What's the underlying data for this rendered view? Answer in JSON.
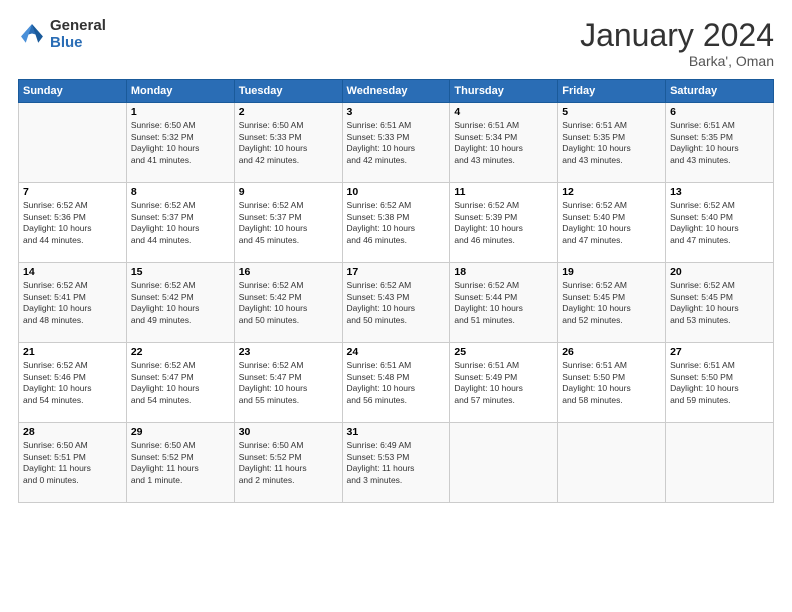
{
  "header": {
    "logo_general": "General",
    "logo_blue": "Blue",
    "month_title": "January 2024",
    "subtitle": "Barka', Oman"
  },
  "weekdays": [
    "Sunday",
    "Monday",
    "Tuesday",
    "Wednesday",
    "Thursday",
    "Friday",
    "Saturday"
  ],
  "weeks": [
    [
      {
        "day": "",
        "info": ""
      },
      {
        "day": "1",
        "info": "Sunrise: 6:50 AM\nSunset: 5:32 PM\nDaylight: 10 hours\nand 41 minutes."
      },
      {
        "day": "2",
        "info": "Sunrise: 6:50 AM\nSunset: 5:33 PM\nDaylight: 10 hours\nand 42 minutes."
      },
      {
        "day": "3",
        "info": "Sunrise: 6:51 AM\nSunset: 5:33 PM\nDaylight: 10 hours\nand 42 minutes."
      },
      {
        "day": "4",
        "info": "Sunrise: 6:51 AM\nSunset: 5:34 PM\nDaylight: 10 hours\nand 43 minutes."
      },
      {
        "day": "5",
        "info": "Sunrise: 6:51 AM\nSunset: 5:35 PM\nDaylight: 10 hours\nand 43 minutes."
      },
      {
        "day": "6",
        "info": "Sunrise: 6:51 AM\nSunset: 5:35 PM\nDaylight: 10 hours\nand 43 minutes."
      }
    ],
    [
      {
        "day": "7",
        "info": "Sunrise: 6:52 AM\nSunset: 5:36 PM\nDaylight: 10 hours\nand 44 minutes."
      },
      {
        "day": "8",
        "info": "Sunrise: 6:52 AM\nSunset: 5:37 PM\nDaylight: 10 hours\nand 44 minutes."
      },
      {
        "day": "9",
        "info": "Sunrise: 6:52 AM\nSunset: 5:37 PM\nDaylight: 10 hours\nand 45 minutes."
      },
      {
        "day": "10",
        "info": "Sunrise: 6:52 AM\nSunset: 5:38 PM\nDaylight: 10 hours\nand 46 minutes."
      },
      {
        "day": "11",
        "info": "Sunrise: 6:52 AM\nSunset: 5:39 PM\nDaylight: 10 hours\nand 46 minutes."
      },
      {
        "day": "12",
        "info": "Sunrise: 6:52 AM\nSunset: 5:40 PM\nDaylight: 10 hours\nand 47 minutes."
      },
      {
        "day": "13",
        "info": "Sunrise: 6:52 AM\nSunset: 5:40 PM\nDaylight: 10 hours\nand 47 minutes."
      }
    ],
    [
      {
        "day": "14",
        "info": "Sunrise: 6:52 AM\nSunset: 5:41 PM\nDaylight: 10 hours\nand 48 minutes."
      },
      {
        "day": "15",
        "info": "Sunrise: 6:52 AM\nSunset: 5:42 PM\nDaylight: 10 hours\nand 49 minutes."
      },
      {
        "day": "16",
        "info": "Sunrise: 6:52 AM\nSunset: 5:42 PM\nDaylight: 10 hours\nand 50 minutes."
      },
      {
        "day": "17",
        "info": "Sunrise: 6:52 AM\nSunset: 5:43 PM\nDaylight: 10 hours\nand 50 minutes."
      },
      {
        "day": "18",
        "info": "Sunrise: 6:52 AM\nSunset: 5:44 PM\nDaylight: 10 hours\nand 51 minutes."
      },
      {
        "day": "19",
        "info": "Sunrise: 6:52 AM\nSunset: 5:45 PM\nDaylight: 10 hours\nand 52 minutes."
      },
      {
        "day": "20",
        "info": "Sunrise: 6:52 AM\nSunset: 5:45 PM\nDaylight: 10 hours\nand 53 minutes."
      }
    ],
    [
      {
        "day": "21",
        "info": "Sunrise: 6:52 AM\nSunset: 5:46 PM\nDaylight: 10 hours\nand 54 minutes."
      },
      {
        "day": "22",
        "info": "Sunrise: 6:52 AM\nSunset: 5:47 PM\nDaylight: 10 hours\nand 54 minutes."
      },
      {
        "day": "23",
        "info": "Sunrise: 6:52 AM\nSunset: 5:47 PM\nDaylight: 10 hours\nand 55 minutes."
      },
      {
        "day": "24",
        "info": "Sunrise: 6:51 AM\nSunset: 5:48 PM\nDaylight: 10 hours\nand 56 minutes."
      },
      {
        "day": "25",
        "info": "Sunrise: 6:51 AM\nSunset: 5:49 PM\nDaylight: 10 hours\nand 57 minutes."
      },
      {
        "day": "26",
        "info": "Sunrise: 6:51 AM\nSunset: 5:50 PM\nDaylight: 10 hours\nand 58 minutes."
      },
      {
        "day": "27",
        "info": "Sunrise: 6:51 AM\nSunset: 5:50 PM\nDaylight: 10 hours\nand 59 minutes."
      }
    ],
    [
      {
        "day": "28",
        "info": "Sunrise: 6:50 AM\nSunset: 5:51 PM\nDaylight: 11 hours\nand 0 minutes."
      },
      {
        "day": "29",
        "info": "Sunrise: 6:50 AM\nSunset: 5:52 PM\nDaylight: 11 hours\nand 1 minute."
      },
      {
        "day": "30",
        "info": "Sunrise: 6:50 AM\nSunset: 5:52 PM\nDaylight: 11 hours\nand 2 minutes."
      },
      {
        "day": "31",
        "info": "Sunrise: 6:49 AM\nSunset: 5:53 PM\nDaylight: 11 hours\nand 3 minutes."
      },
      {
        "day": "",
        "info": ""
      },
      {
        "day": "",
        "info": ""
      },
      {
        "day": "",
        "info": ""
      }
    ]
  ]
}
